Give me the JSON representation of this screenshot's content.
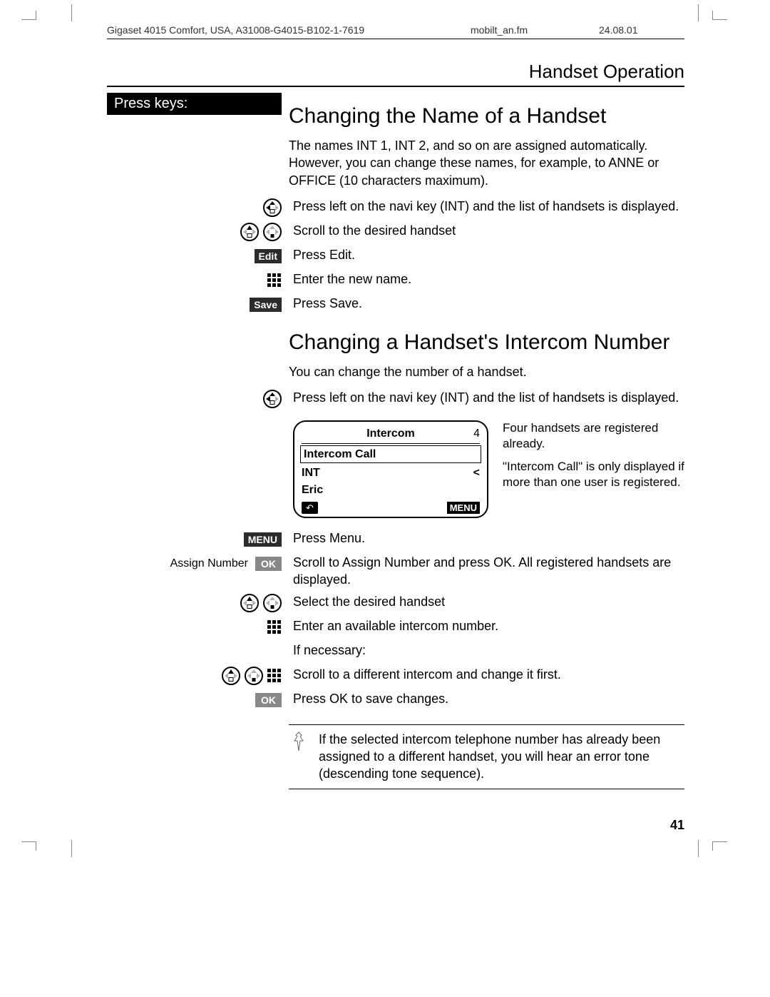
{
  "header": {
    "left": "Gigaset 4015 Comfort, USA, A31008-G4015-B102-1-7619",
    "mid": "mobilt_an.fm",
    "right": "24.08.01"
  },
  "section": "Handset Operation",
  "sidebar": {
    "label": "Press keys:"
  },
  "topic1": {
    "title": "Changing the Name of a Handset",
    "intro": "The names INT 1, INT 2, and so on are assigned automatically. However, you can change these names, for example, to ANNE or OFFICE (10 characters maximum).",
    "steps": [
      {
        "text": "Press left on the navi key (INT) and the list of handsets is displayed."
      },
      {
        "text": "Scroll to the desired handset"
      },
      {
        "key": "Edit",
        "text": "Press Edit."
      },
      {
        "text": "Enter the new name."
      },
      {
        "key": "Save",
        "text": "Press Save."
      }
    ]
  },
  "topic2": {
    "title": "Changing a Handset's Intercom Number",
    "intro": "You can change the number of a handset.",
    "step_left": "Press left on the navi key (INT) and the list of handsets is displayed.",
    "display": {
      "title": "Intercom",
      "num": "4",
      "row1": "Intercom Call",
      "row2": "INT",
      "row2_arrow": "<",
      "row3": "Eric",
      "sk_back": "↶",
      "sk_menu": "MENU"
    },
    "callout1": "Four handsets are registered already.",
    "callout2": "\"Intercom Call\" is only displayed if more than one user is registered.",
    "step_menu_key": "MENU",
    "step_menu": "Press Menu.",
    "assign_label": "Assign Number",
    "assign_key": "OK",
    "step_assign": "Scroll to Assign Number and press OK. All registered handsets are displayed.",
    "step_select": "Select the desired handset",
    "step_enter": "Enter an available intercom number.",
    "step_ifnec": "If necessary:",
    "step_scroll_diff": "Scroll to a different intercom and change it first.",
    "ok_key": "OK",
    "step_ok": "Press OK to save changes.",
    "note": "If the selected intercom telephone number has already been assigned to a different handset, you will hear an error tone (descending tone sequence)."
  },
  "page_num": "41"
}
